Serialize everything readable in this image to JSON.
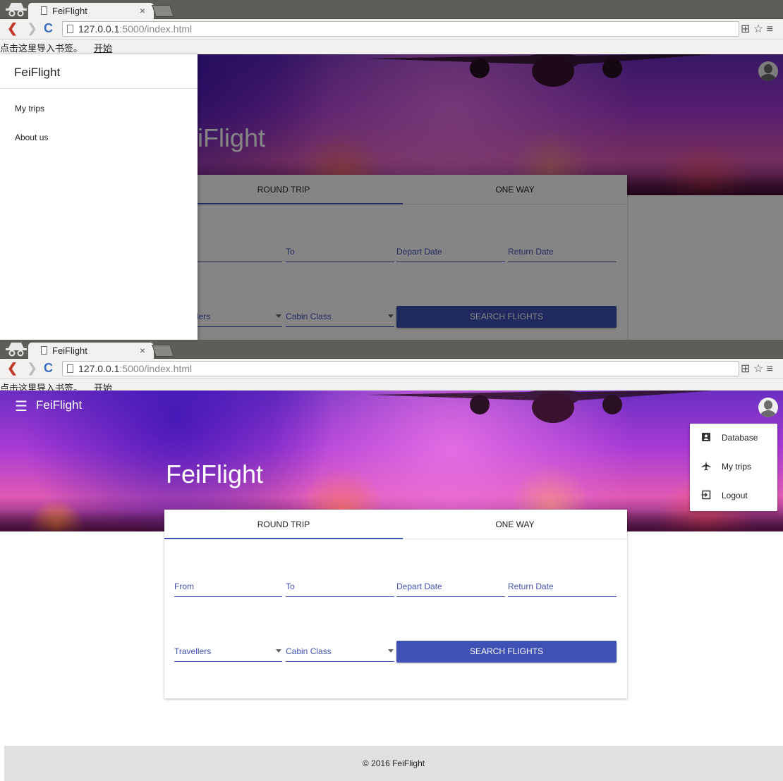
{
  "browser": {
    "tab_title": "FeiFlight",
    "tab_close": "×",
    "url_host": "127.0.0.1",
    "url_rest": ":5000/index.html",
    "bookmark_prompt": "点击这里导入书签。",
    "bookmark_link": "开始"
  },
  "app": {
    "brand": "FeiFlight",
    "hero_title": "FeiFlight",
    "hero_title_partial": "iFlight",
    "menu_icon": "☰"
  },
  "drawer": {
    "title": "FeiFlight",
    "items": [
      {
        "label": "My trips"
      },
      {
        "label": "About us"
      }
    ]
  },
  "user_menu": {
    "items": [
      {
        "label": "Database",
        "icon": "database-icon"
      },
      {
        "label": "My trips",
        "icon": "airplane-icon"
      },
      {
        "label": "Logout",
        "icon": "logout-icon"
      }
    ]
  },
  "search": {
    "tabs": [
      {
        "label": "ROUND TRIP",
        "active": true
      },
      {
        "label": "ONE WAY",
        "active": false
      }
    ],
    "fields": {
      "from": "From",
      "to": "To",
      "depart": "Depart Date",
      "return": "Return Date",
      "travellers": "Travellers",
      "travellers_partial": "lers",
      "cabin": "Cabin Class"
    },
    "button": "SEARCH FLIGHTS"
  },
  "footer": {
    "text": "© 2016 FeiFlight"
  },
  "colors": {
    "primary": "#3f51b5",
    "footer_bg": "#e0e0e0"
  }
}
